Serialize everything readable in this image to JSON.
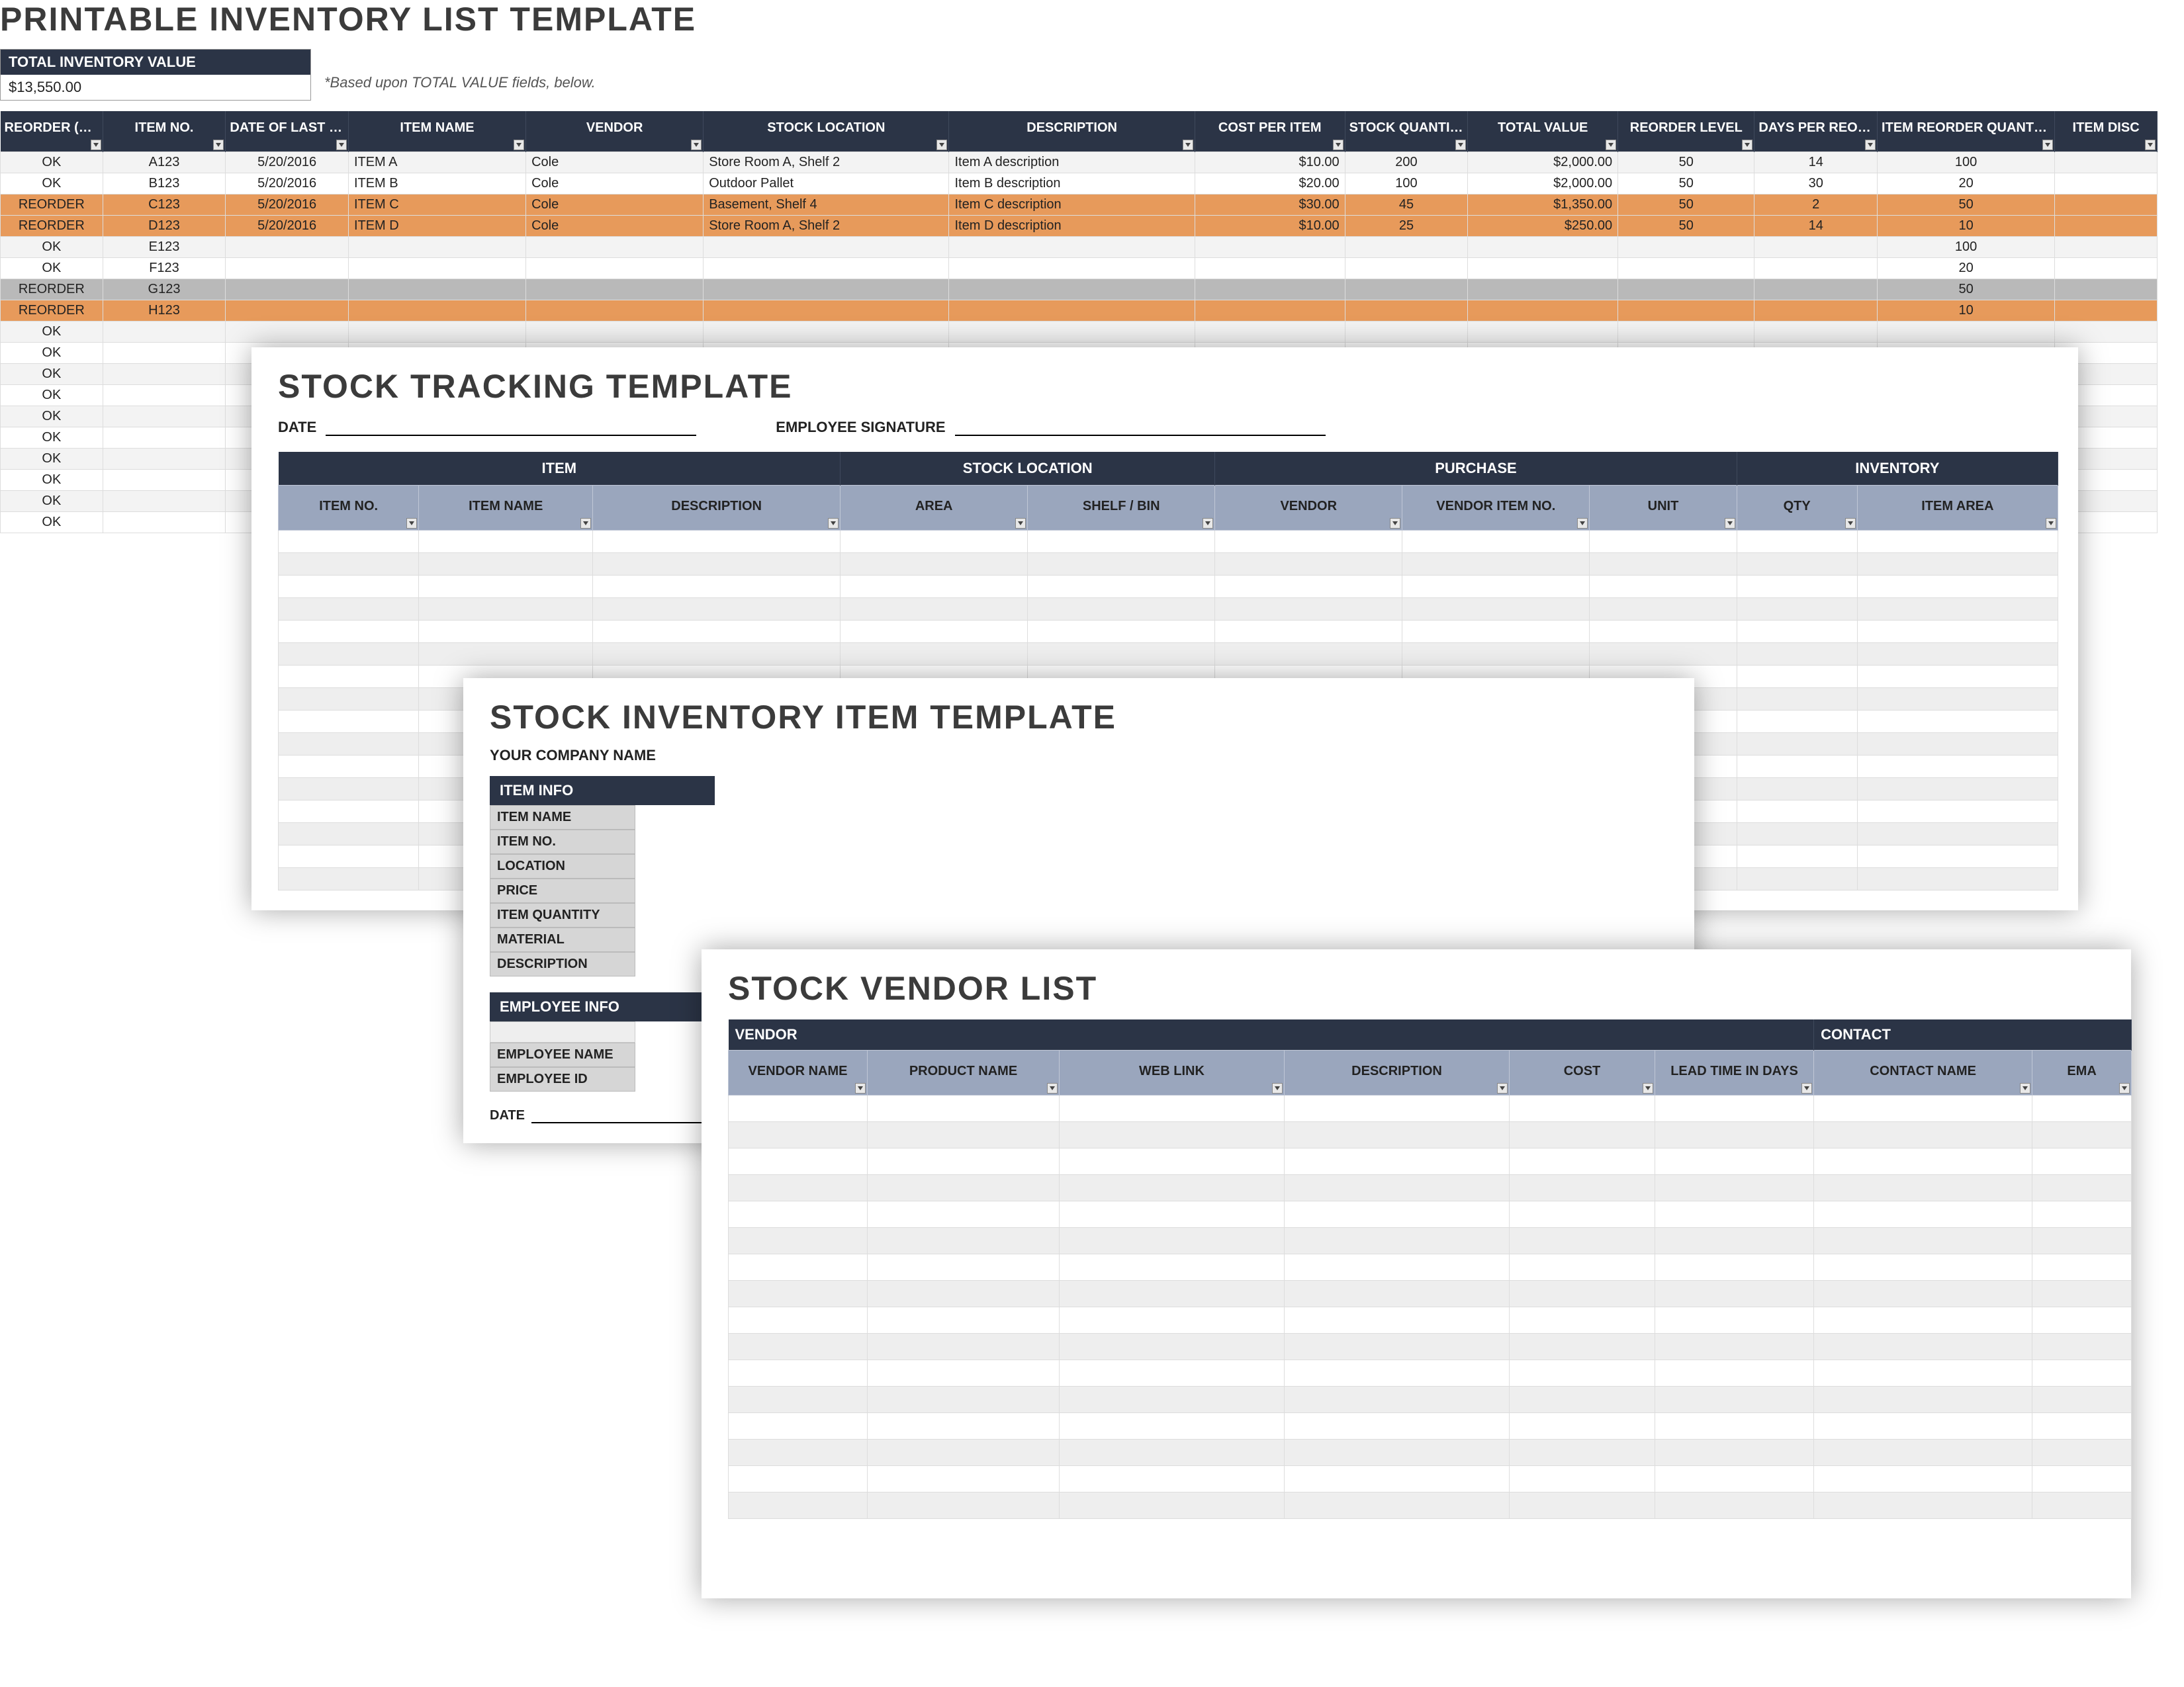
{
  "panel1": {
    "title": "PRINTABLE INVENTORY LIST TEMPLATE",
    "total_value_label": "TOTAL INVENTORY VALUE",
    "total_value": "$13,550.00",
    "total_value_note": "*Based upon TOTAL VALUE fields, below.",
    "columns": [
      "REORDER (auto-fill)",
      "ITEM NO.",
      "DATE OF LAST ORDER",
      "ITEM NAME",
      "VENDOR",
      "STOCK LOCATION",
      "DESCRIPTION",
      "COST PER ITEM",
      "STOCK QUANTITY",
      "TOTAL VALUE",
      "REORDER LEVEL",
      "DAYS PER REORDER",
      "ITEM REORDER QUANTITY",
      "ITEM DISC"
    ],
    "rows": [
      {
        "status": "OK",
        "no": "A123",
        "date": "5/20/2016",
        "name": "ITEM A",
        "vendor": "Cole",
        "loc": "Store Room A, Shelf 2",
        "desc": "Item A description",
        "cost": "$10.00",
        "qty": "200",
        "total": "$2,000.00",
        "rl": "50",
        "dpr": "14",
        "irq": "100",
        "cls": "gray"
      },
      {
        "status": "OK",
        "no": "B123",
        "date": "5/20/2016",
        "name": "ITEM B",
        "vendor": "Cole",
        "loc": "Outdoor Pallet",
        "desc": "Item B description",
        "cost": "$20.00",
        "qty": "100",
        "total": "$2,000.00",
        "rl": "50",
        "dpr": "30",
        "irq": "20",
        "cls": ""
      },
      {
        "status": "REORDER",
        "no": "C123",
        "date": "5/20/2016",
        "name": "ITEM C",
        "vendor": "Cole",
        "loc": "Basement, Shelf 4",
        "desc": "Item C description",
        "cost": "$30.00",
        "qty": "45",
        "total": "$1,350.00",
        "rl": "50",
        "dpr": "2",
        "irq": "50",
        "cls": "reorder"
      },
      {
        "status": "REORDER",
        "no": "D123",
        "date": "5/20/2016",
        "name": "ITEM D",
        "vendor": "Cole",
        "loc": "Store Room A, Shelf 2",
        "desc": "Item D description",
        "cost": "$10.00",
        "qty": "25",
        "total": "$250.00",
        "rl": "50",
        "dpr": "14",
        "irq": "10",
        "cls": "reorder"
      },
      {
        "status": "OK",
        "no": "E123",
        "date": "",
        "name": "",
        "vendor": "",
        "loc": "",
        "desc": "",
        "cost": "",
        "qty": "",
        "total": "",
        "rl": "",
        "dpr": "",
        "irq": "100",
        "cls": ""
      },
      {
        "status": "OK",
        "no": "F123",
        "date": "",
        "name": "",
        "vendor": "",
        "loc": "",
        "desc": "",
        "cost": "",
        "qty": "",
        "total": "",
        "rl": "",
        "dpr": "",
        "irq": "20",
        "cls": ""
      },
      {
        "status": "REORDER",
        "no": "G123",
        "date": "",
        "name": "",
        "vendor": "",
        "loc": "",
        "desc": "",
        "cost": "",
        "qty": "",
        "total": "",
        "rl": "",
        "dpr": "",
        "irq": "50",
        "cls": "reorder-gray"
      },
      {
        "status": "REORDER",
        "no": "H123",
        "date": "",
        "name": "",
        "vendor": "",
        "loc": "",
        "desc": "",
        "cost": "",
        "qty": "",
        "total": "",
        "rl": "",
        "dpr": "",
        "irq": "10",
        "cls": "reorder"
      },
      {
        "status": "OK",
        "no": "",
        "date": "",
        "name": "",
        "vendor": "",
        "loc": "",
        "desc": "",
        "cost": "",
        "qty": "",
        "total": "",
        "rl": "",
        "dpr": "",
        "irq": "",
        "cls": ""
      },
      {
        "status": "OK",
        "no": "",
        "date": "",
        "name": "",
        "vendor": "",
        "loc": "",
        "desc": "",
        "cost": "",
        "qty": "",
        "total": "",
        "rl": "",
        "dpr": "",
        "irq": "",
        "cls": ""
      },
      {
        "status": "OK",
        "no": "",
        "date": "",
        "name": "",
        "vendor": "",
        "loc": "",
        "desc": "",
        "cost": "",
        "qty": "",
        "total": "",
        "rl": "",
        "dpr": "",
        "irq": "",
        "cls": ""
      },
      {
        "status": "OK",
        "no": "",
        "date": "",
        "name": "",
        "vendor": "",
        "loc": "",
        "desc": "",
        "cost": "",
        "qty": "",
        "total": "",
        "rl": "",
        "dpr": "",
        "irq": "",
        "cls": ""
      },
      {
        "status": "OK",
        "no": "",
        "date": "",
        "name": "",
        "vendor": "",
        "loc": "",
        "desc": "",
        "cost": "",
        "qty": "",
        "total": "",
        "rl": "",
        "dpr": "",
        "irq": "",
        "cls": ""
      },
      {
        "status": "OK",
        "no": "",
        "date": "",
        "name": "",
        "vendor": "",
        "loc": "",
        "desc": "",
        "cost": "",
        "qty": "",
        "total": "",
        "rl": "",
        "dpr": "",
        "irq": "",
        "cls": ""
      },
      {
        "status": "OK",
        "no": "",
        "date": "",
        "name": "",
        "vendor": "",
        "loc": "",
        "desc": "",
        "cost": "",
        "qty": "",
        "total": "",
        "rl": "",
        "dpr": "",
        "irq": "",
        "cls": ""
      },
      {
        "status": "OK",
        "no": "",
        "date": "",
        "name": "",
        "vendor": "",
        "loc": "",
        "desc": "",
        "cost": "",
        "qty": "",
        "total": "",
        "rl": "",
        "dpr": "",
        "irq": "",
        "cls": ""
      },
      {
        "status": "OK",
        "no": "",
        "date": "",
        "name": "",
        "vendor": "",
        "loc": "",
        "desc": "",
        "cost": "",
        "qty": "",
        "total": "",
        "rl": "",
        "dpr": "",
        "irq": "",
        "cls": ""
      },
      {
        "status": "OK",
        "no": "",
        "date": "",
        "name": "",
        "vendor": "",
        "loc": "",
        "desc": "",
        "cost": "",
        "qty": "",
        "total": "",
        "rl": "",
        "dpr": "",
        "irq": "",
        "cls": ""
      }
    ]
  },
  "panel2": {
    "title": "STOCK TRACKING TEMPLATE",
    "fields": {
      "date": "DATE",
      "signature": "EMPLOYEE SIGNATURE"
    },
    "groups": [
      "ITEM",
      "STOCK LOCATION",
      "PURCHASE",
      "INVENTORY"
    ],
    "columns": [
      "ITEM NO.",
      "ITEM NAME",
      "DESCRIPTION",
      "AREA",
      "SHELF / BIN",
      "VENDOR",
      "VENDOR ITEM NO.",
      "UNIT",
      "QTY",
      "ITEM AREA"
    ],
    "group_spans": [
      3,
      2,
      3,
      2
    ],
    "empty_rows": 16
  },
  "panel3": {
    "title": "STOCK INVENTORY ITEM TEMPLATE",
    "company_label": "YOUR COMPANY NAME",
    "item_info": {
      "header": "ITEM INFO",
      "rows": [
        "ITEM NAME",
        "ITEM NO.",
        "LOCATION",
        "PRICE",
        "ITEM QUANTITY",
        "MATERIAL",
        "DESCRIPTION"
      ]
    },
    "employee_info": {
      "header": "EMPLOYEE INFO",
      "rows": [
        "EMPLOYEE NAME",
        "EMPLOYEE ID"
      ]
    },
    "date_label": "DATE"
  },
  "panel4": {
    "title": "STOCK VENDOR LIST",
    "groups": [
      "VENDOR",
      "CONTACT"
    ],
    "group_spans": [
      6,
      2
    ],
    "columns": [
      "VENDOR NAME",
      "PRODUCT NAME",
      "WEB LINK",
      "DESCRIPTION",
      "COST",
      "LEAD TIME IN DAYS",
      "CONTACT NAME",
      "EMA"
    ],
    "empty_rows": 16
  }
}
